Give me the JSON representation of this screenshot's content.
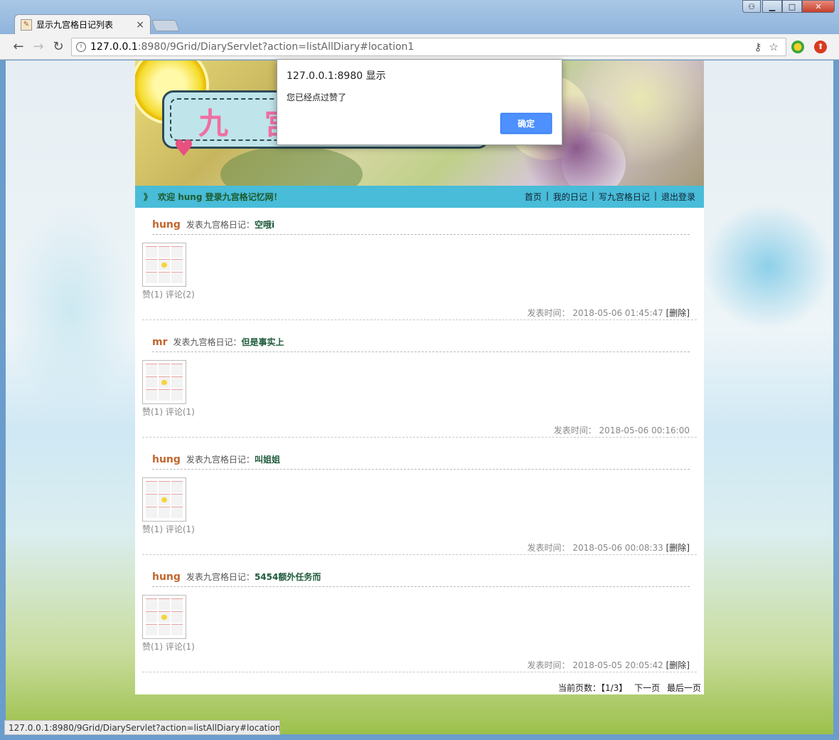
{
  "browser": {
    "tab_title": "显示九宫格日记列表",
    "tab_close": "×",
    "url_host": "127.0.0.1",
    "url_rest": ":8980/9Grid/DiaryServlet?action=listAllDiary#location1",
    "status_url": "127.0.0.1:8980/9Grid/DiaryServlet?action=listAllDiary#location1"
  },
  "banner": {
    "title_chars": "九 宫"
  },
  "nav": {
    "welcome": "欢迎 hung 登录九宫格记忆网！",
    "welcome_arrow": "》",
    "links": [
      "首页",
      "我的日记",
      "写九宫格日记",
      "退出登录"
    ]
  },
  "posts": [
    {
      "author": "hung",
      "posted_label": "发表九宫格日记：",
      "title": "空哦i",
      "like": "赞(1)",
      "comment": "评论(2)",
      "time_label": "发表时间：",
      "time": "2018-05-06 01:45:47",
      "delete": "[删除]"
    },
    {
      "author": "mr",
      "posted_label": "发表九宫格日记：",
      "title": "但是事实上",
      "like": "赞(1)",
      "comment": "评论(1)",
      "time_label": "发表时间：",
      "time": "2018-05-06 00:16:00",
      "delete": ""
    },
    {
      "author": "hung",
      "posted_label": "发表九宫格日记：",
      "title": "叫姐姐",
      "like": "赞(1)",
      "comment": "评论(1)",
      "time_label": "发表时间：",
      "time": "2018-05-06 00:08:33",
      "delete": "[删除]"
    },
    {
      "author": "hung",
      "posted_label": "发表九宫格日记：",
      "title": "5454额外任务而",
      "like": "赞(1)",
      "comment": "评论(1)",
      "time_label": "发表时间：",
      "time": "2018-05-05 20:05:42",
      "delete": "[删除]"
    }
  ],
  "pager": {
    "label": "当前页数：",
    "current": "【1/3】",
    "next": "下一页",
    "last": "最后一页"
  },
  "dialog": {
    "title": "127.0.0.1:8980 显示",
    "message": "您已经点过赞了",
    "ok": "确定"
  },
  "colors": {
    "accent_nav": "#48bcd8",
    "author": "#c2662e",
    "ok_button": "#4d90fe"
  }
}
